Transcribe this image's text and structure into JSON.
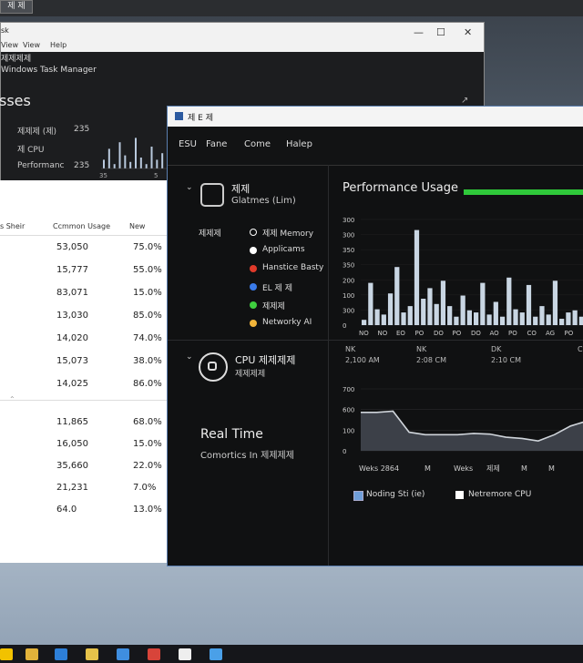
{
  "top_button": "제 제",
  "back_window": {
    "title_text": "sk",
    "menu": [
      "View",
      "View",
      "Help"
    ],
    "header_line1": "제제제제",
    "header_line2": "Windows Task Manager",
    "section_title": "sses",
    "summary": [
      {
        "label": "제제제 (제)",
        "value": "235"
      },
      {
        "label": "제 CPU",
        "value": ""
      },
      {
        "label": "Performanc",
        "value": "235"
      }
    ]
  },
  "process_list": {
    "headers": [
      "s Sheir",
      "Ccmmon Usage",
      "New"
    ],
    "rows_top": [
      {
        "a": "53,050",
        "b": "75.0%"
      },
      {
        "a": "15,777",
        "b": "55.0%"
      },
      {
        "a": "83,071",
        "b": "15.0%"
      },
      {
        "a": "13,030",
        "b": "85.0%"
      },
      {
        "a": "14,020",
        "b": "74.0%"
      },
      {
        "a": "15,073",
        "b": "38.0%"
      },
      {
        "a": "14,025",
        "b": "86.0%"
      }
    ],
    "rows_bottom": [
      {
        "a": "11,865",
        "b": "68.0%"
      },
      {
        "a": "16,050",
        "b": "15.0%"
      },
      {
        "a": "35,660",
        "b": "22.0%"
      },
      {
        "a": "21,231",
        "b": "7.0%"
      },
      {
        "a": "64.0",
        "b": "13.0%"
      }
    ]
  },
  "front_window": {
    "title": "제 E 제",
    "menu": [
      "ESU",
      "Fane",
      "Come",
      "Halep"
    ],
    "disk_title": "제제",
    "disk_subtitle": "Glatmes (Lim)",
    "legend_header": "제제제",
    "legend": [
      {
        "label": "제제 Memory",
        "color": "#ffffff",
        "hollow": true
      },
      {
        "label": "Applicams",
        "color": "#ffffff",
        "hollow": false
      },
      {
        "label": "Hanstice Basty",
        "color": "#e03a2a",
        "hollow": false
      },
      {
        "label": "EL 제 제",
        "color": "#3a7bea",
        "hollow": false
      },
      {
        "label": "제제제",
        "color": "#3fcf3f",
        "hollow": false
      },
      {
        "label": "Networky AI",
        "color": "#f2b53a",
        "hollow": false
      }
    ],
    "cpu_title": "CPU 제제제제",
    "cpu_subtitle": "제제제제",
    "realtime_title": "Real Time",
    "realtime_subtitle": "Comortics In 제제제제",
    "perf_title": "Performance Usage",
    "time_headers": [
      {
        "l1": "NK",
        "l2": "2,100 AM"
      },
      {
        "l1": "NK",
        "l2": "2:08 CM"
      },
      {
        "l1": "DK",
        "l2": "2:10 CM"
      },
      {
        "l1": "C",
        "l2": ""
      }
    ],
    "line_x_labels": [
      "Weks 2864",
      "M",
      "Weks",
      "제제",
      "M",
      "M"
    ],
    "bottom_legend": [
      "Noding Sti (ie)",
      "Netremore CPU"
    ]
  },
  "bar_chart": {
    "yticks": [
      "300",
      "300",
      "350",
      "350",
      "200",
      "100",
      "300",
      "0"
    ],
    "xticks": [
      "NO",
      "NO",
      "EO",
      "PO",
      "DO",
      "PO",
      "DO",
      "AO",
      "PO",
      "CO",
      "AG",
      "PO"
    ],
    "values": [
      5,
      40,
      15,
      10,
      30,
      55,
      12,
      18,
      90,
      25,
      35,
      20,
      42,
      18,
      8,
      28,
      14,
      12,
      40,
      10,
      22,
      8,
      45,
      15,
      12,
      38,
      8,
      18,
      10,
      42,
      6,
      12,
      14,
      8
    ],
    "bar_color": "#c9d6e3",
    "ymax": 100
  },
  "line_chart": {
    "yticks": [
      "700",
      "600",
      "100",
      "0"
    ],
    "values": [
      62,
      62,
      64,
      30,
      26,
      26,
      26,
      28,
      27,
      22,
      20,
      16,
      26,
      40,
      48
    ],
    "ymax": 100,
    "line_color": "#cfd4da",
    "fill_color": "#3c4048"
  },
  "mini_chart": {
    "values": [
      20,
      45,
      10,
      60,
      30,
      15,
      70,
      25,
      10,
      50,
      20,
      35
    ],
    "xlabels": [
      "35",
      "",
      "5"
    ]
  }
}
